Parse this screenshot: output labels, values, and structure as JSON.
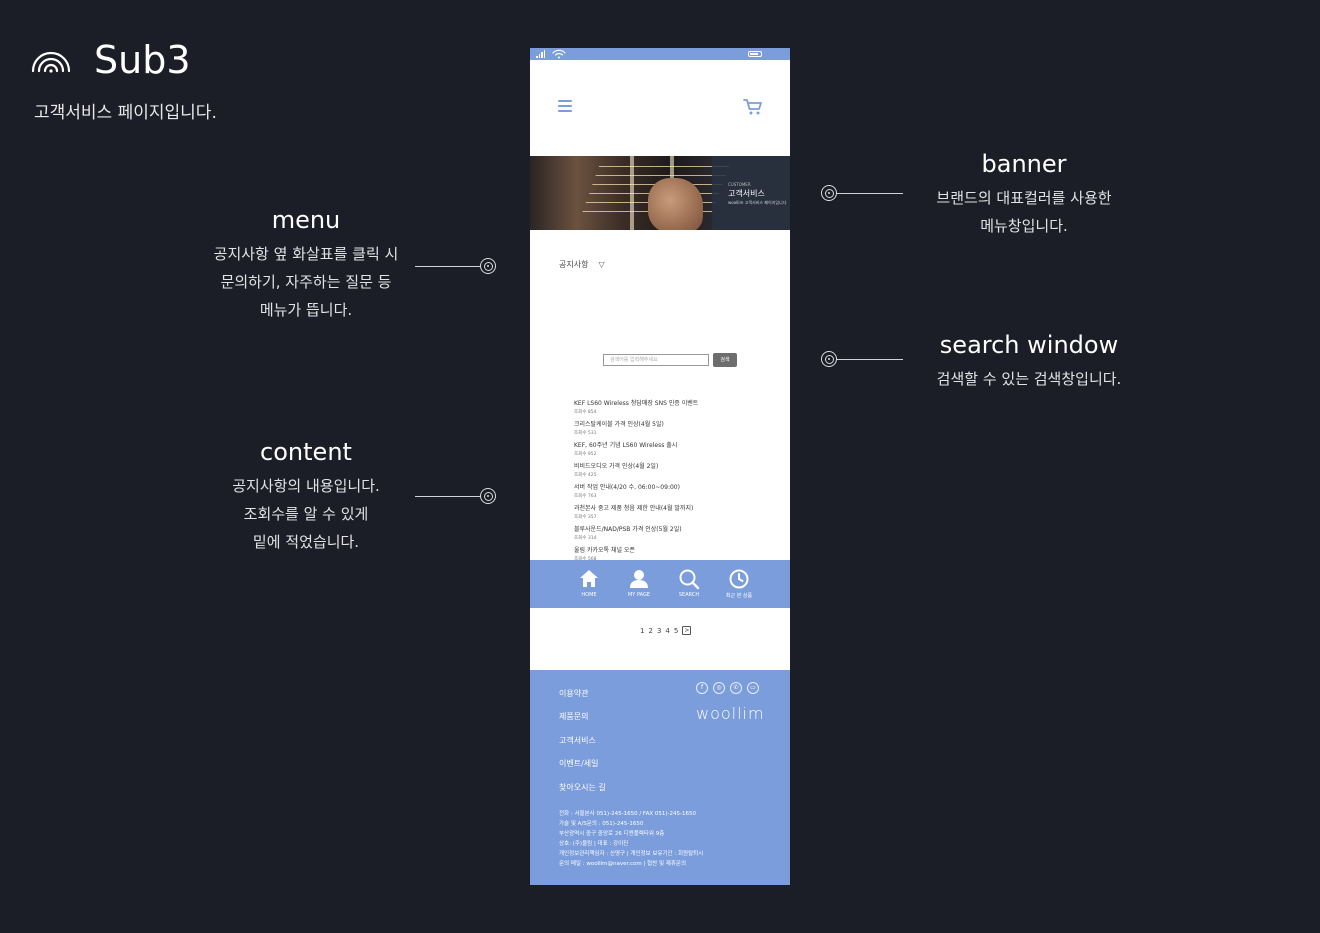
{
  "header": {
    "title": "Sub3",
    "subtitle": "고객서비스 페이지입니다."
  },
  "annotations": {
    "menu": {
      "title": "menu",
      "lines": [
        "공지사항 옆 화살표를 클릭 시",
        "문의하기, 자주하는 질문 등",
        "메뉴가 뜹니다."
      ]
    },
    "content": {
      "title": "content",
      "lines": [
        "공지사항의 내용입니다.",
        "조회수를 알 수 있게",
        "밑에 적었습니다."
      ]
    },
    "banner": {
      "title": "banner",
      "lines": [
        "브랜드의 대표컬러를 사용한",
        "메뉴창입니다."
      ]
    },
    "search": {
      "title": "search window",
      "lines": [
        "검색할 수 있는 검색창입니다."
      ]
    }
  },
  "phone": {
    "banner": {
      "small": "CUSTOMER",
      "title": "고객서비스",
      "desc": "woollim 고객서비스 페이지입니다"
    },
    "menu_select": {
      "label": "공지사항",
      "arrow": "▽"
    },
    "search": {
      "placeholder": "검색어를 입력해주세요",
      "button": "검색"
    },
    "notices": [
      {
        "title": "KEF LS60 Wireless 청담매장 SNS 인증 이벤트",
        "views": "조회수 854"
      },
      {
        "title": "크리스탈케이블 가격 인상(4월 5일)",
        "views": "조회수 531"
      },
      {
        "title": "KEF, 60주년 기념 LS60 Wireless 출시",
        "views": "조회수 952"
      },
      {
        "title": "비비드오디오 가격 인상(4월 2일)",
        "views": "조회수 425"
      },
      {
        "title": "서버 작업 안내(4/20 수, 06:00~09:00)",
        "views": "조회수 763"
      },
      {
        "title": "과천본사 중고 제품 청음 제한 안내(4월 말까지)",
        "views": "조회수 357"
      },
      {
        "title": "블루사운드/NAD/PSB 가격 인상(5월 2일)",
        "views": "조회수 314"
      },
      {
        "title": "울림 카카오톡 채널 오픈",
        "views": "조회수 568"
      }
    ],
    "nav": [
      {
        "label": "HOME",
        "icon": "home-icon"
      },
      {
        "label": "MY PAGE",
        "icon": "user-icon"
      },
      {
        "label": "SEARCH",
        "icon": "search-icon"
      },
      {
        "label": "최근 본 상품",
        "icon": "clock-icon"
      }
    ],
    "pagination": {
      "pages": [
        "1",
        "2",
        "3",
        "4",
        "5"
      ],
      "next": ">"
    },
    "footer": {
      "links": [
        "이용약관",
        "제품문의",
        "고객서비스",
        "이벤트/세일",
        "찾아오시는 길"
      ],
      "brand": "woollim",
      "info": [
        "전화 : 서울본사 051)-245-1650 / FAX 051)-245-1650",
        "가술 및 A/S문의 : 051)-245-1650",
        "부산광역시 중구 중앙로 26 디엔플렉타워 9층",
        "상호: (주)울림 | 대표 : 강이진",
        "개인정보관리책임자 : 신명구 | 개인정보 보유기간 : 회원탈퇴시",
        "문의 메일 : woollim@naver.com | 협찬 및 제휴문의"
      ]
    }
  },
  "colors": {
    "background": "#1b1e26",
    "brand": "#7b9ddb"
  }
}
